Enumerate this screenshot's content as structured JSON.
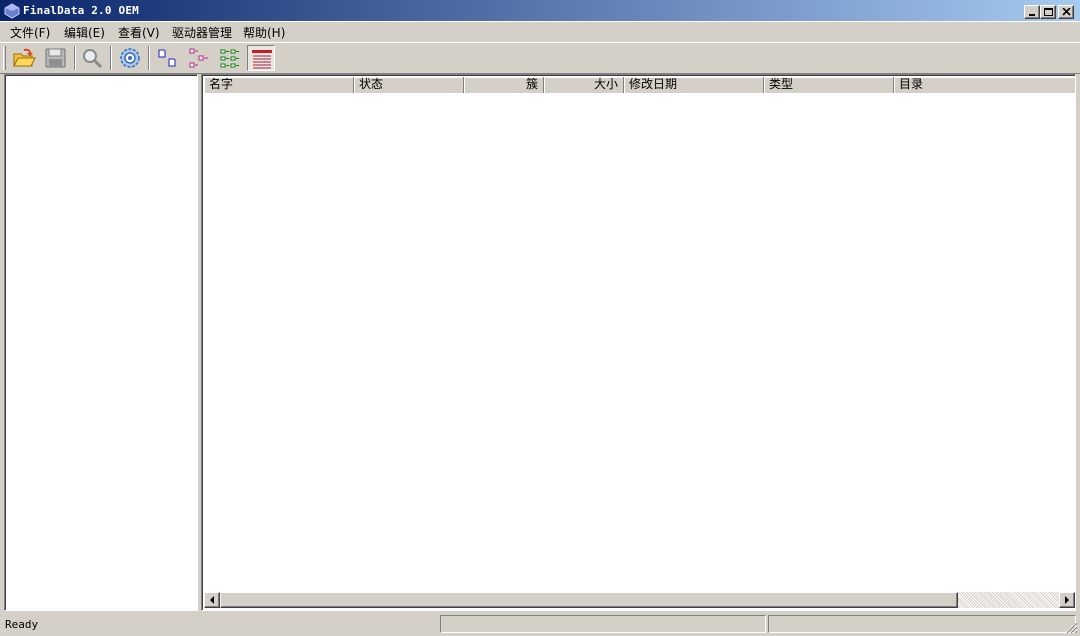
{
  "window": {
    "title": "FinalData 2.0 OEM",
    "buttons": [
      "minimize",
      "maximize",
      "close"
    ],
    "colors": {
      "titlebar_start": "#0a246a",
      "titlebar_end": "#a6caf0",
      "face": "#d4d0c8"
    }
  },
  "menu": {
    "items": [
      {
        "label": "文件(F)"
      },
      {
        "label": "编辑(E)"
      },
      {
        "label": "查看(V)"
      },
      {
        "label": "驱动器管理"
      },
      {
        "label": "帮助(H)"
      }
    ]
  },
  "toolbar": {
    "buttons": [
      {
        "icon": "open-folder-icon"
      },
      {
        "icon": "save-icon"
      },
      {
        "icon": "search-icon"
      },
      {
        "icon": "settings-gear-icon"
      },
      {
        "icon": "large-icons-view-icon"
      },
      {
        "icon": "small-icons-view-icon"
      },
      {
        "icon": "list-view-icon"
      },
      {
        "icon": "details-view-icon",
        "pressed": true
      }
    ]
  },
  "file_list": {
    "columns": [
      "名字",
      "状态",
      "簇",
      "大小",
      "修改日期",
      "类型",
      "目录"
    ],
    "rows": []
  },
  "statusbar": {
    "text": "Ready"
  }
}
